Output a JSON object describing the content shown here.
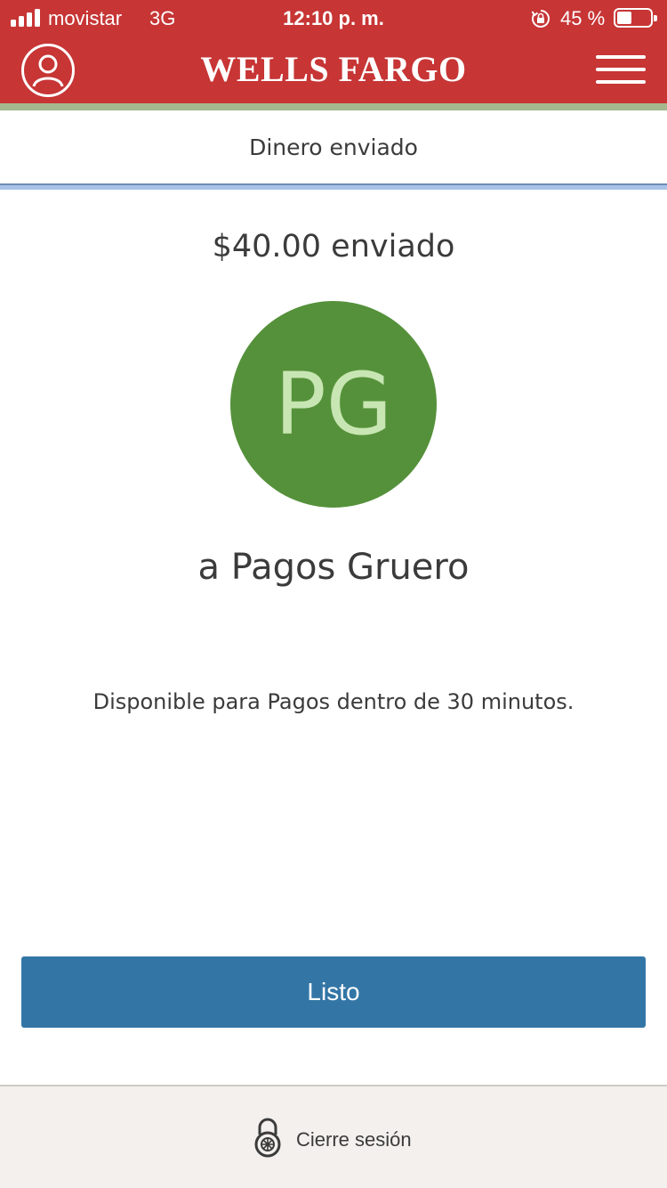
{
  "status_bar": {
    "carrier": "movistar",
    "network": "3G",
    "time": "12:10 p. m.",
    "battery_percent": "45 %",
    "battery_level": 0.45
  },
  "header": {
    "brand": "WELLS FARGO",
    "brand_color": "#c73535"
  },
  "subheader": {
    "title": "Dinero enviado"
  },
  "confirmation": {
    "amount_text": "$40.00 enviado",
    "avatar_initials": "PG",
    "avatar_color": "#55913a",
    "recipient_text": "a Pagos Gruero",
    "availability_text": "Disponible para Pagos dentro de 30 minutos."
  },
  "actions": {
    "done_label": "Listo",
    "button_color": "#3376a6"
  },
  "footer": {
    "logout_label": "Cierre sesión"
  }
}
